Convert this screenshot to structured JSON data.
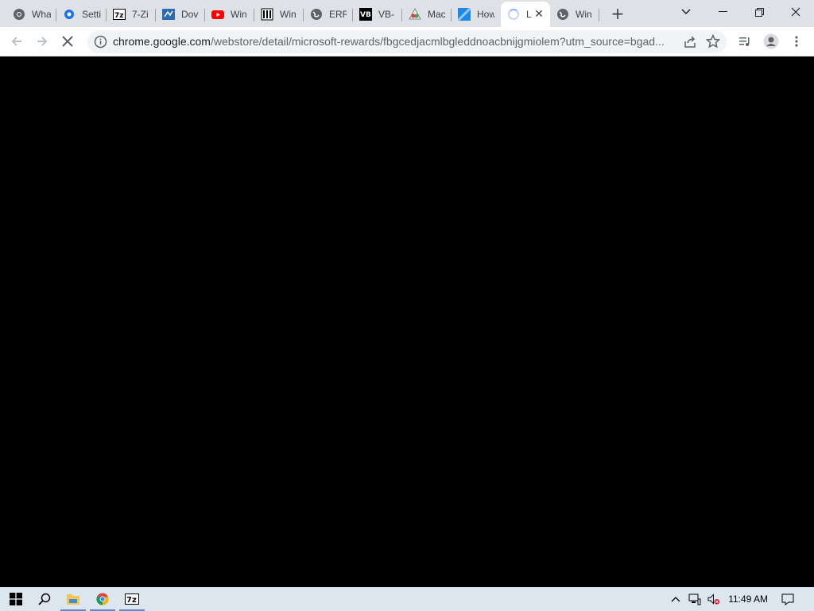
{
  "tabs": [
    {
      "title": "What",
      "icon": "chrome-icon"
    },
    {
      "title": "Setti",
      "icon": "gear-icon"
    },
    {
      "title": "7-Zi",
      "icon": "7zip-icon"
    },
    {
      "title": "Dov",
      "icon": "download-site-icon"
    },
    {
      "title": "Win",
      "icon": "youtube-icon"
    },
    {
      "title": "Win",
      "icon": "book-icon"
    },
    {
      "title": "ERR",
      "icon": "globe-icon"
    },
    {
      "title": "VB-",
      "icon": "vb-icon"
    },
    {
      "title": "Mac",
      "icon": "macrium-icon"
    },
    {
      "title": "How",
      "icon": "blue-cross-icon"
    },
    {
      "title": "L",
      "icon": "loading-spinner-icon",
      "active": true
    },
    {
      "title": "Win",
      "icon": "globe-icon"
    }
  ],
  "toolbar": {
    "url_host": "chrome.google.com",
    "url_rest": "/webstore/detail/microsoft-rewards/fbgcedjacmlbgleddnoacbnijgmiolem?utm_source=bgad..."
  },
  "taskbar": {
    "clock": "11:49 AM"
  },
  "colors": {
    "tabstrip": "#dee1e6",
    "content": "#000000",
    "taskbar": "#dce6ef"
  }
}
